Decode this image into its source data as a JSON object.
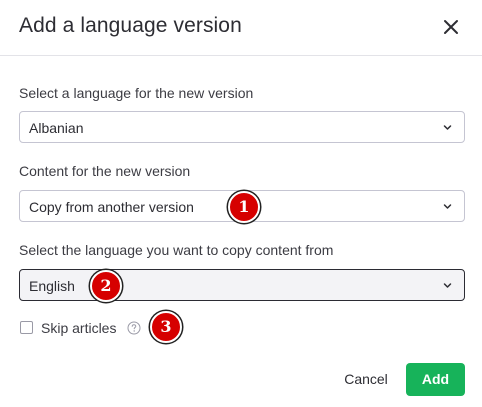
{
  "dialog": {
    "title": "Add a language version",
    "close_icon": "close-icon"
  },
  "fields": {
    "language": {
      "label": "Select a language for the new version",
      "value": "Albanian"
    },
    "content": {
      "label": "Content for the new version",
      "value": "Copy from another version"
    },
    "source_language": {
      "label": "Select the language you want to copy content from",
      "value": "English"
    }
  },
  "skip_articles": {
    "label": "Skip articles",
    "checked": false,
    "help_icon": "help-circle-icon"
  },
  "badges": [
    "1",
    "2",
    "3"
  ],
  "actions": {
    "cancel_label": "Cancel",
    "add_label": "Add"
  },
  "colors": {
    "primary_button": "#17b35a",
    "badge": "#d60000",
    "text": "#2d2d33",
    "border": "#c5c5d2"
  }
}
